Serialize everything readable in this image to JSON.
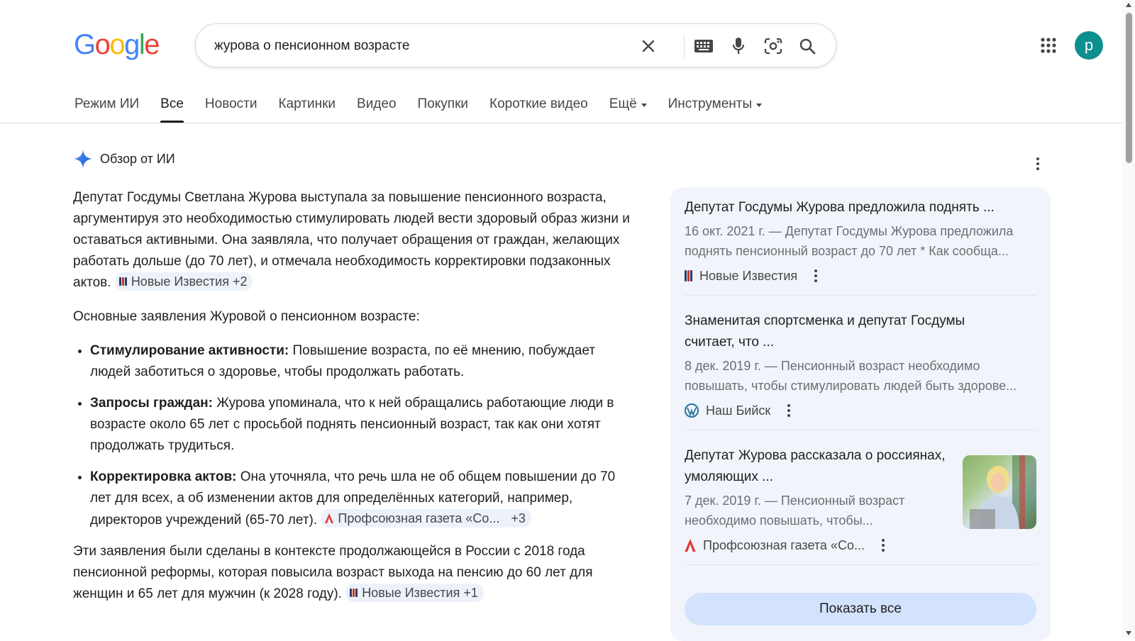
{
  "header": {
    "logo": [
      "G",
      "o",
      "o",
      "g",
      "l",
      "e"
    ],
    "logo_colors": [
      "#4285f4",
      "#ea4335",
      "#fbbc05",
      "#4285f4",
      "#34a853",
      "#ea4335"
    ],
    "search_value": "журова о пенсионном возрасте",
    "avatar_letter": "p"
  },
  "tabs": [
    {
      "label": "Режим ИИ"
    },
    {
      "label": "Все"
    },
    {
      "label": "Новости"
    },
    {
      "label": "Картинки"
    },
    {
      "label": "Видео"
    },
    {
      "label": "Покупки"
    },
    {
      "label": "Короткие видео"
    },
    {
      "label": "Ещё"
    },
    {
      "label": "Инструменты"
    }
  ],
  "ai": {
    "title": "Обзор от ИИ",
    "p1": "Депутат Госдумы Светлана Журова выступала за повышение пенсионного возраста, аргументируя это необходимостью стимулировать людей вести здоровый образ жизни и оставаться активными. Она заявляла, что получает обращения от граждан, желающих работать дольше (до 70 лет), и отмечала необходимость корректировки подзаконных актов.",
    "chip1": "Новые Известия +2",
    "p2": "Основные заявления Журовой о пенсионном возрасте:",
    "bullets": [
      {
        "bold": "Стимулирование активности:",
        "text": " Повышение возраста, по её мнению, побуждает людей заботиться о здоровье, чтобы продолжать работать."
      },
      {
        "bold": "Запросы граждан:",
        "text": " Журова упоминала, что к ней обращались работающие люди в возрасте около 65 лет с просьбой поднять пенсионный возраст, так как они хотят продолжать трудиться."
      },
      {
        "bold": "Корректировка актов:",
        "text": " Она уточняла, что речь шла не об общем повышении до 70 лет для всех, а об изменении актов для определённых категорий, например, директоров учреждений (65-70 лет)."
      }
    ],
    "chip2_name": "Профсоюзная газета «Со...",
    "chip2_count": "+3",
    "p3": "Эти заявления были сделаны в контексте продолжающейся в России с 2018 года пенсионной реформы, которая повысила возраст выхода на пенсию до 60 лет для женщин и 65 лет для мужчин (к 2028 году).",
    "chip3": "Новые Известия +1"
  },
  "sources": [
    {
      "title": "Депутат Госдумы Журова предложила поднять ...",
      "snippet": "16 окт. 2021 г. — Депутат Госдумы Журова предложила поднять пенсионный возраст до 70 лет * Как сообща...",
      "site": "Новые Известия"
    },
    {
      "title": "Знаменитая спортсменка и депутат Госдумы считает, что ...",
      "snippet": "8 дек. 2019 г. — Пенсионный возраст необходимо повышать, чтобы стимулировать людей быть здорове...",
      "site": "Наш Бийск"
    },
    {
      "title": "Депутат Журова рассказала о россиянах, умоляющих ...",
      "snippet": "7 дек. 2019 г. — Пенсионный возраст необходимо повышать, чтобы...",
      "site": "Профсоюзная газета «Со..."
    }
  ],
  "show_all": "Показать все"
}
